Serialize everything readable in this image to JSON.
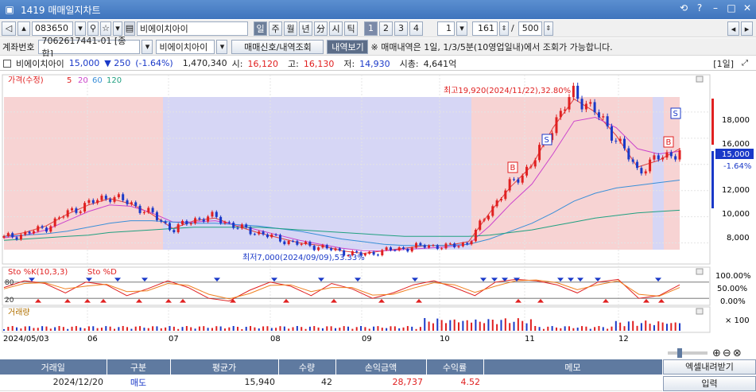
{
  "window": {
    "title": "1419 매매일지차트"
  },
  "toolbar1": {
    "stock_code": "083650",
    "stock_name": "비에이치아이",
    "periods": [
      "일",
      "주",
      "월",
      "년",
      "分",
      "시",
      "틱"
    ],
    "active_period": "일",
    "numbers": [
      "1",
      "2",
      "3",
      "4"
    ],
    "interval": "1",
    "count": "161",
    "total": "500",
    "slash": "/"
  },
  "toolbar2": {
    "account_label": "계좌번호",
    "account": "7062617441-01 [종합]",
    "account_name": "비에이치아이",
    "btn_signals": "매매신호/내역조회",
    "btn_history": "내역보기",
    "notice": "※ 매매내역은 1일, 1/3/5분(10영업일내)에서 조회가 가능합니다."
  },
  "info": {
    "name": "비에이치아이",
    "price": "15,000",
    "change": "▼ 250",
    "change_pct": "(-1.64%)",
    "volume": "1,470,340",
    "open_label": "시:",
    "open": "16,120",
    "high_label": "고:",
    "high": "16,130",
    "low_label": "저:",
    "low": "14,930",
    "mcap_label": "시총:",
    "mcap": "4,641억",
    "period_tag": "[1일]"
  },
  "chart_data": [
    {
      "type": "line",
      "name": "price",
      "legend": [
        "가격(수정)",
        "5",
        "20",
        "60",
        "120"
      ],
      "x": [
        "2024/05/03",
        "06",
        "07",
        "08",
        "09",
        "10",
        "11",
        "12"
      ],
      "ylim": [
        7000,
        20000
      ],
      "yticks": [
        "18,000",
        "16,000",
        "14,000",
        "12,000",
        "10,000",
        "8,000"
      ],
      "current_price": "15,000",
      "current_pct": "-1.64%",
      "annotations": {
        "high": "최고19,920(2024/11/22),32.80%",
        "low": "최저7,000(2024/09/09),53.33%"
      },
      "markers": [
        "S",
        "B",
        "S",
        "B"
      ],
      "series": [
        {
          "values": [
            8400,
            8700,
            9200,
            10300,
            11000,
            11600,
            11000,
            10200,
            9000,
            9800,
            10000,
            9200,
            8800,
            8300,
            7900,
            7700,
            7300,
            7100,
            7400,
            7600,
            7800,
            7700,
            8000,
            10500,
            12500,
            14000,
            17000,
            19500,
            18000,
            16000,
            13500,
            14500,
            15000
          ]
        },
        {
          "name": "5",
          "values": [
            8500,
            8800,
            9300,
            10200,
            10900,
            11400,
            11000,
            10200,
            9100,
            9700,
            9900,
            9300,
            8800,
            8400,
            8000,
            7800,
            7400,
            7200,
            7400,
            7600,
            7800,
            7800,
            8100,
            10300,
            12300,
            13900,
            16800,
            19000,
            18000,
            16200,
            13800,
            14300,
            15200
          ]
        },
        {
          "name": "20",
          "values": [
            8400,
            8600,
            9000,
            9700,
            10400,
            10900,
            10800,
            10300,
            9600,
            9600,
            9700,
            9400,
            9000,
            8600,
            8200,
            7900,
            7600,
            7400,
            7400,
            7500,
            7600,
            7700,
            7900,
            9300,
            11000,
            12500,
            14800,
            17300,
            17600,
            16800,
            15200,
            14800,
            15000
          ]
        },
        {
          "name": "60",
          "values": [
            8500,
            8600,
            8700,
            8900,
            9200,
            9500,
            9700,
            9700,
            9600,
            9500,
            9500,
            9400,
            9300,
            9100,
            8900,
            8600,
            8300,
            8100,
            7900,
            7800,
            7800,
            7800,
            7900,
            8300,
            8900,
            9500,
            10300,
            11200,
            11800,
            12200,
            12400,
            12600,
            12800
          ]
        },
        {
          "name": "120",
          "values": [
            8200,
            8300,
            8400,
            8500,
            8600,
            8800,
            8900,
            9000,
            9100,
            9200,
            9200,
            9200,
            9200,
            9100,
            9000,
            8900,
            8800,
            8700,
            8600,
            8500,
            8500,
            8500,
            8500,
            8600,
            8800,
            9000,
            9300,
            9600,
            9900,
            10100,
            10300,
            10400,
            10500
          ]
        }
      ]
    },
    {
      "type": "line",
      "name": "stochastic",
      "legend": [
        "Sto %K(10,3,3)",
        "Sto %D"
      ],
      "ylim": [
        0,
        100
      ],
      "yticks": [
        "100.00%",
        "50.00%",
        "0.00%"
      ],
      "levels": [
        "80",
        "20"
      ],
      "series": [
        {
          "values": [
            60,
            85,
            75,
            40,
            80,
            70,
            30,
            55,
            85,
            60,
            20,
            10,
            50,
            80,
            65,
            30,
            75,
            55,
            20,
            40,
            70,
            85,
            60,
            30,
            80,
            90,
            85,
            70,
            40,
            80,
            90,
            20,
            30,
            70
          ]
        },
        {
          "values": [
            55,
            75,
            78,
            55,
            65,
            72,
            45,
            48,
            75,
            68,
            35,
            18,
            38,
            68,
            70,
            45,
            60,
            60,
            32,
            35,
            58,
            78,
            70,
            42,
            65,
            85,
            88,
            78,
            52,
            70,
            85,
            35,
            28,
            60
          ]
        }
      ]
    },
    {
      "type": "bar",
      "name": "volume",
      "legend": [
        "거래량"
      ],
      "yticks": [
        "× 100"
      ]
    }
  ],
  "table": {
    "headers": [
      "거래일",
      "구분",
      "평균가",
      "수량",
      "손익금액",
      "수익률",
      "메모"
    ],
    "rows": [
      [
        "2024/12/20",
        "매도",
        "15,940",
        "42",
        "28,737",
        "4.52",
        ""
      ]
    ]
  },
  "side_buttons": {
    "excel": "엑셀내려받기",
    "input": "입력"
  },
  "colors": {
    "up": "#e02020",
    "down": "#1a39c8",
    "header": "#5f7aa0",
    "buy_zone": "#f7d3d3",
    "sell_zone": "#d6d6f5"
  }
}
